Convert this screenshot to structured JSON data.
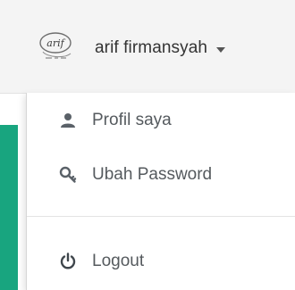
{
  "user": {
    "name": "arif firmansyah",
    "avatar_text": "arif"
  },
  "menu": {
    "profile_label": "Profil saya",
    "password_label": "Ubah Password",
    "logout_label": "Logout"
  },
  "icons": {
    "profile": "user-icon",
    "password": "key-icon",
    "logout": "power-icon",
    "caret": "caret-down-icon"
  },
  "colors": {
    "topbar_bg": "#f4f4f4",
    "accent_green": "#18a57f",
    "menu_text": "#555a5e",
    "user_text": "#333333"
  }
}
